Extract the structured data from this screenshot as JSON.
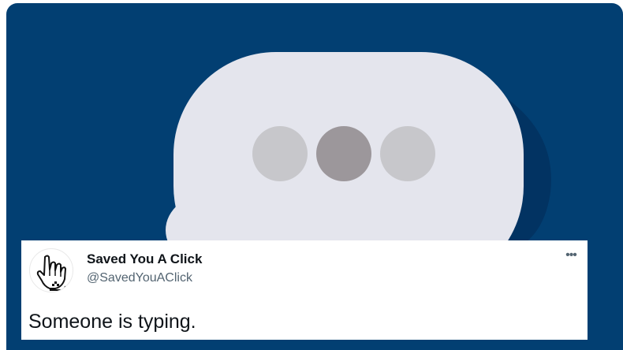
{
  "tweet": {
    "display_name": "Saved You A Click",
    "handle": "@SavedYouAClick",
    "text": "Someone is typing.",
    "more_label": "•••"
  },
  "icons": {
    "avatar": "hand-cursor-icon",
    "more": "more-options-icon",
    "hero": "typing-indicator-bubble"
  },
  "colors": {
    "hero_background": "#023f72",
    "bubble": "#e4e5ed",
    "bubble_shadow": "#023362",
    "dot_light": "#c7c7cb",
    "dot_dark": "#9c979b",
    "text_primary": "#0f1419",
    "text_secondary": "#536471"
  }
}
